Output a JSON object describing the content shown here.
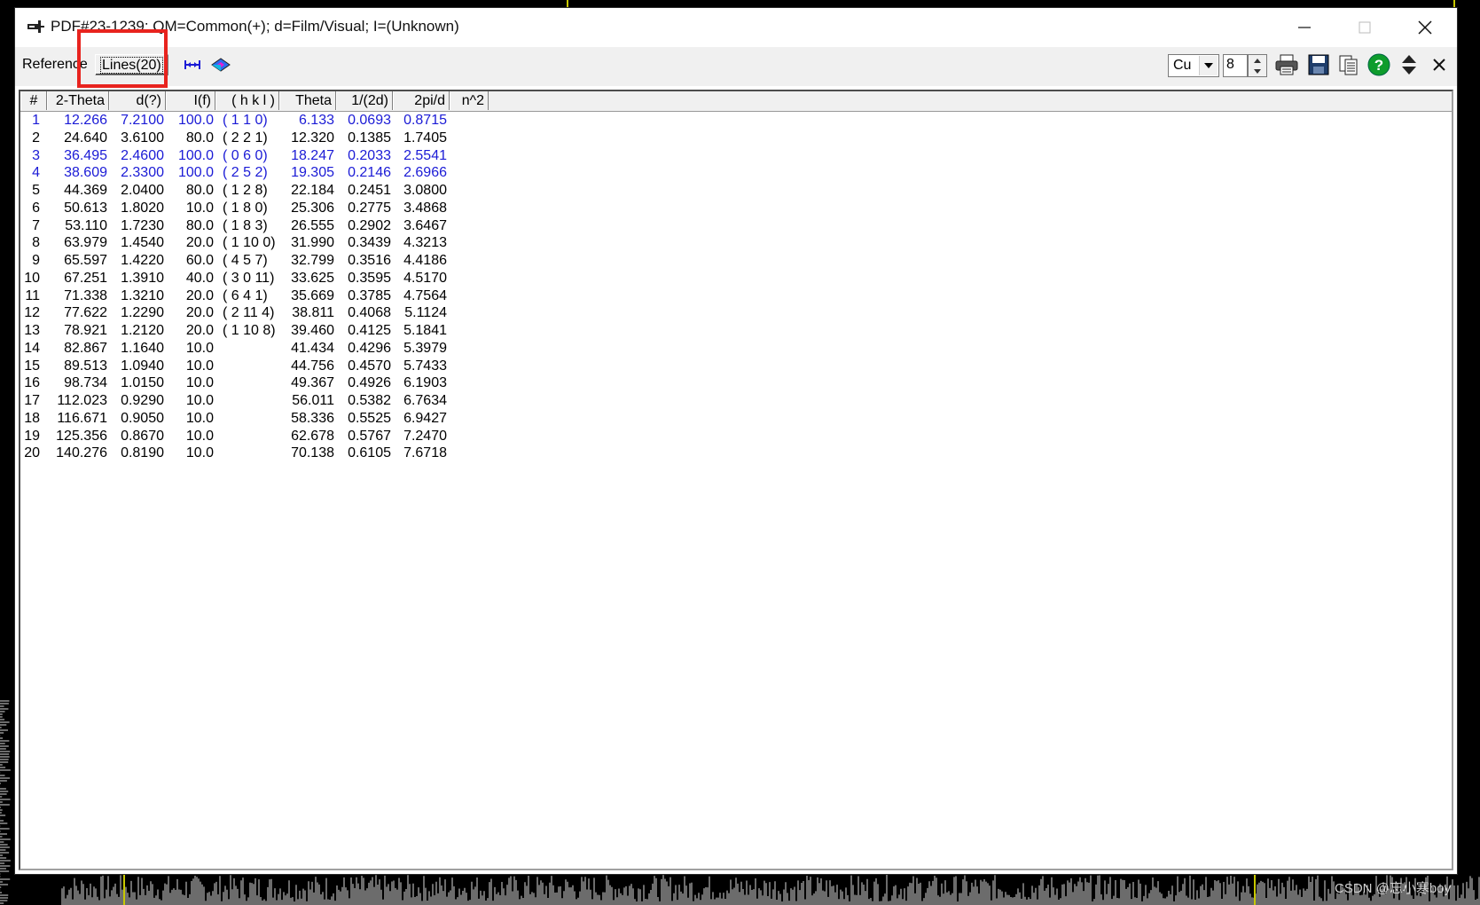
{
  "window": {
    "title": "PDF#23-1239: QM=Common(+); d=Film/Visual; I=(Unknown)"
  },
  "toolbar": {
    "tab_reference": "Reference",
    "tab_lines": "Lines(20)",
    "radiation_select": "Cu",
    "decimals_value": "8",
    "icons": [
      "range-icon",
      "diffraction-icon",
      "print-icon",
      "save-icon",
      "copy-icon",
      "help-icon",
      "sort-icon",
      "close-x-icon"
    ]
  },
  "table": {
    "headers": [
      "#",
      "2-Theta",
      "d(?)",
      "I(f)",
      "( h k l )",
      "Theta",
      "1/(2d)",
      "2pi/d",
      "n^2"
    ],
    "rows": [
      {
        "n": "1",
        "two_theta": "12.266",
        "d": "7.2100",
        "i": "100.0",
        "hkl": "( 1 1 0)",
        "theta": "6.133",
        "inv2d": "0.0693",
        "twopid": "0.8715",
        "color": "blue"
      },
      {
        "n": "2",
        "two_theta": "24.640",
        "d": "3.6100",
        "i": "80.0",
        "hkl": "( 2 2 1)",
        "theta": "12.320",
        "inv2d": "0.1385",
        "twopid": "1.7405",
        "color": "black"
      },
      {
        "n": "3",
        "two_theta": "36.495",
        "d": "2.4600",
        "i": "100.0",
        "hkl": "( 0 6 0)",
        "theta": "18.247",
        "inv2d": "0.2033",
        "twopid": "2.5541",
        "color": "blue"
      },
      {
        "n": "4",
        "two_theta": "38.609",
        "d": "2.3300",
        "i": "100.0",
        "hkl": "( 2 5 2)",
        "theta": "19.305",
        "inv2d": "0.2146",
        "twopid": "2.6966",
        "color": "blue"
      },
      {
        "n": "5",
        "two_theta": "44.369",
        "d": "2.0400",
        "i": "80.0",
        "hkl": "( 1 2 8)",
        "theta": "22.184",
        "inv2d": "0.2451",
        "twopid": "3.0800",
        "color": "black"
      },
      {
        "n": "6",
        "two_theta": "50.613",
        "d": "1.8020",
        "i": "10.0",
        "hkl": "( 1 8 0)",
        "theta": "25.306",
        "inv2d": "0.2775",
        "twopid": "3.4868",
        "color": "black"
      },
      {
        "n": "7",
        "two_theta": "53.110",
        "d": "1.7230",
        "i": "80.0",
        "hkl": "( 1 8 3)",
        "theta": "26.555",
        "inv2d": "0.2902",
        "twopid": "3.6467",
        "color": "black"
      },
      {
        "n": "8",
        "two_theta": "63.979",
        "d": "1.4540",
        "i": "20.0",
        "hkl": "( 1 10 0)",
        "theta": "31.990",
        "inv2d": "0.3439",
        "twopid": "4.3213",
        "color": "black"
      },
      {
        "n": "9",
        "two_theta": "65.597",
        "d": "1.4220",
        "i": "60.0",
        "hkl": "( 4 5 7)",
        "theta": "32.799",
        "inv2d": "0.3516",
        "twopid": "4.4186",
        "color": "black"
      },
      {
        "n": "10",
        "two_theta": "67.251",
        "d": "1.3910",
        "i": "40.0",
        "hkl": "( 3 0 11)",
        "theta": "33.625",
        "inv2d": "0.3595",
        "twopid": "4.5170",
        "color": "black"
      },
      {
        "n": "11",
        "two_theta": "71.338",
        "d": "1.3210",
        "i": "20.0",
        "hkl": "( 6 4 1)",
        "theta": "35.669",
        "inv2d": "0.3785",
        "twopid": "4.7564",
        "color": "black"
      },
      {
        "n": "12",
        "two_theta": "77.622",
        "d": "1.2290",
        "i": "20.0",
        "hkl": "( 2 11 4)",
        "theta": "38.811",
        "inv2d": "0.4068",
        "twopid": "5.1124",
        "color": "black"
      },
      {
        "n": "13",
        "two_theta": "78.921",
        "d": "1.2120",
        "i": "20.0",
        "hkl": "( 1 10 8)",
        "theta": "39.460",
        "inv2d": "0.4125",
        "twopid": "5.1841",
        "color": "black"
      },
      {
        "n": "14",
        "two_theta": "82.867",
        "d": "1.1640",
        "i": "10.0",
        "hkl": "",
        "theta": "41.434",
        "inv2d": "0.4296",
        "twopid": "5.3979",
        "color": "black"
      },
      {
        "n": "15",
        "two_theta": "89.513",
        "d": "1.0940",
        "i": "10.0",
        "hkl": "",
        "theta": "44.756",
        "inv2d": "0.4570",
        "twopid": "5.7433",
        "color": "black"
      },
      {
        "n": "16",
        "two_theta": "98.734",
        "d": "1.0150",
        "i": "10.0",
        "hkl": "",
        "theta": "49.367",
        "inv2d": "0.4926",
        "twopid": "6.1903",
        "color": "black"
      },
      {
        "n": "17",
        "two_theta": "112.023",
        "d": "0.9290",
        "i": "10.0",
        "hkl": "",
        "theta": "56.011",
        "inv2d": "0.5382",
        "twopid": "6.7634",
        "color": "black"
      },
      {
        "n": "18",
        "two_theta": "116.671",
        "d": "0.9050",
        "i": "10.0",
        "hkl": "",
        "theta": "58.336",
        "inv2d": "0.5525",
        "twopid": "6.9427",
        "color": "black"
      },
      {
        "n": "19",
        "two_theta": "125.356",
        "d": "0.8670",
        "i": "10.0",
        "hkl": "",
        "theta": "62.678",
        "inv2d": "0.5767",
        "twopid": "7.2470",
        "color": "black"
      },
      {
        "n": "20",
        "two_theta": "140.276",
        "d": "0.8190",
        "i": "10.0",
        "hkl": "",
        "theta": "70.138",
        "inv2d": "0.6105",
        "twopid": "7.6718",
        "color": "black"
      }
    ]
  },
  "colors": {
    "highlight_row": "#1b1bd6",
    "annotation_box": "#e8231e"
  },
  "watermark": "CSDN @忘小寒boy"
}
